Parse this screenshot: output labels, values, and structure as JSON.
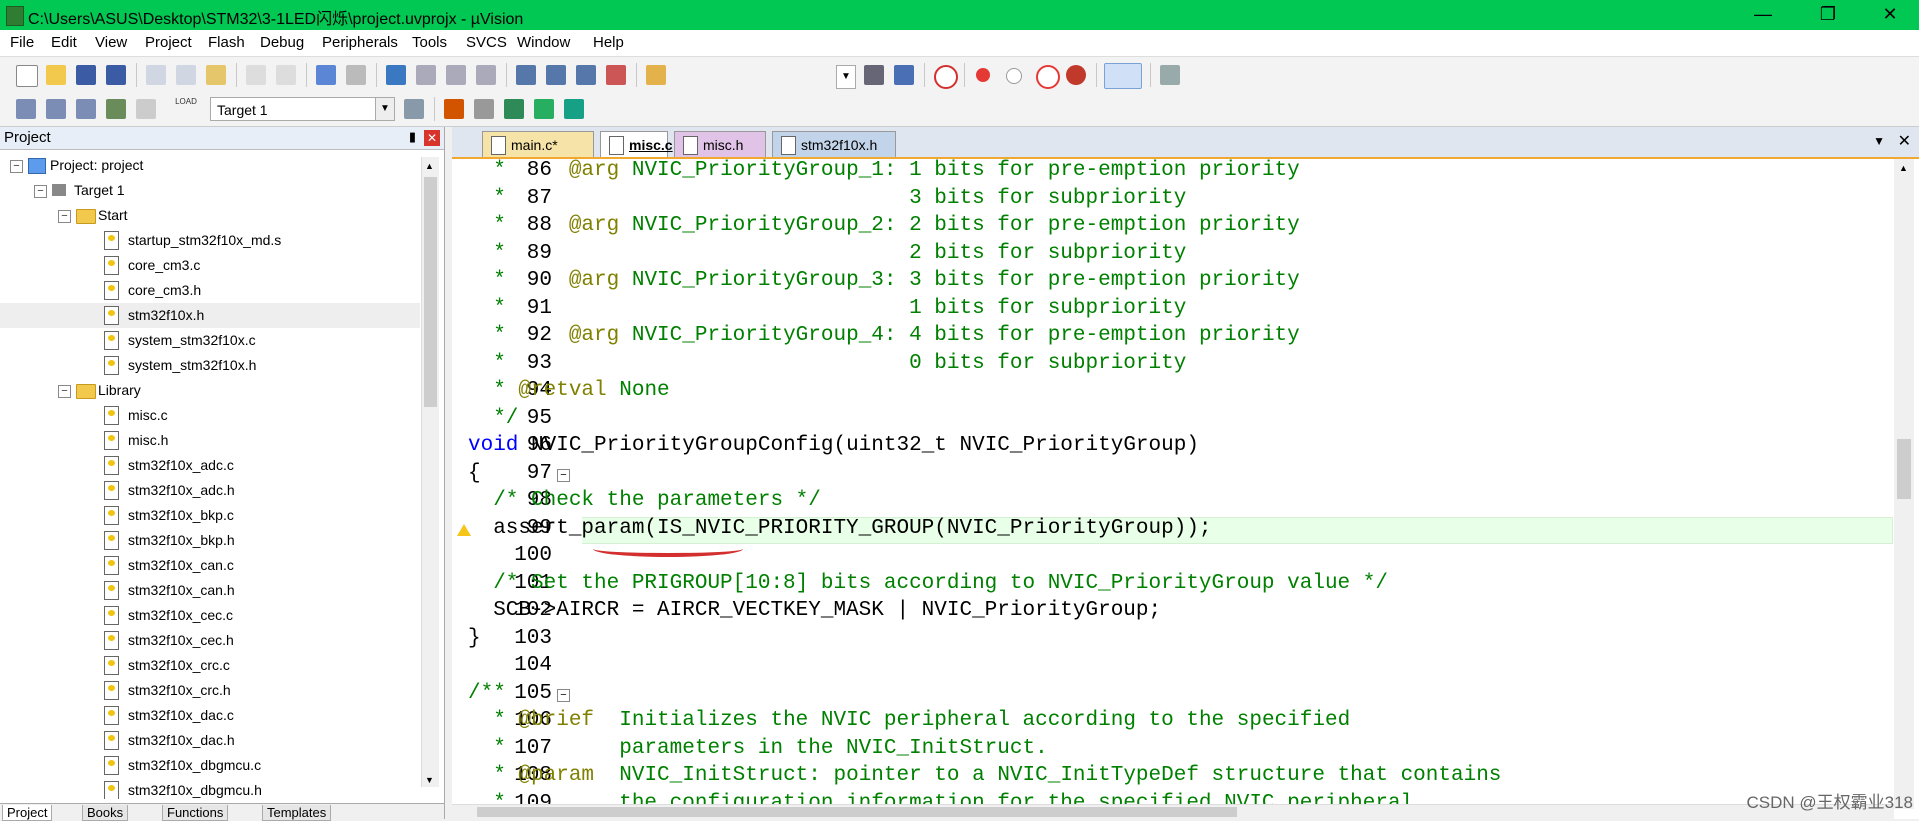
{
  "window": {
    "title": "C:\\Users\\ASUS\\Desktop\\STM32\\3-1LED闪烁\\project.uvprojx - µVision",
    "controls": [
      "minimize-icon",
      "maximize-icon",
      "close-icon"
    ],
    "colors": {
      "titlebar": "#00c853",
      "accent": "#f0a830"
    }
  },
  "menu": [
    "File",
    "Edit",
    "View",
    "Project",
    "Flash",
    "Debug",
    "Peripherals",
    "Tools",
    "SVCS",
    "Window",
    "Help"
  ],
  "toolbar2": {
    "target": "Target 1",
    "load_label": "LOAD"
  },
  "project_panel": {
    "title": "Project",
    "root": "Project: project",
    "target": "Target 1",
    "groups": [
      {
        "name": "Start",
        "files": [
          "startup_stm32f10x_md.s",
          "core_cm3.c",
          "core_cm3.h",
          "stm32f10x.h",
          "system_stm32f10x.c",
          "system_stm32f10x.h"
        ]
      },
      {
        "name": "Library",
        "files": [
          "misc.c",
          "misc.h",
          "stm32f10x_adc.c",
          "stm32f10x_adc.h",
          "stm32f10x_bkp.c",
          "stm32f10x_bkp.h",
          "stm32f10x_can.c",
          "stm32f10x_can.h",
          "stm32f10x_cec.c",
          "stm32f10x_cec.h",
          "stm32f10x_crc.c",
          "stm32f10x_crc.h",
          "stm32f10x_dac.c",
          "stm32f10x_dac.h",
          "stm32f10x_dbgmcu.c",
          "stm32f10x_dbgmcu.h"
        ]
      }
    ],
    "selected": "stm32f10x.h",
    "bottom_tabs": [
      "Project",
      "Books",
      "Functions",
      "Templates"
    ]
  },
  "editor": {
    "tabs": [
      {
        "label": "main.c*",
        "active": false
      },
      {
        "label": "misc.c",
        "active": true
      },
      {
        "label": "misc.h",
        "active": false
      },
      {
        "label": "stm32f10x.h",
        "active": false
      }
    ],
    "lines": [
      {
        "n": "86",
        "text": "  *     @arg NVIC_PriorityGroup_1: 1 bits for pre-emption priority"
      },
      {
        "n": "87",
        "text": "  *                                3 bits for subpriority"
      },
      {
        "n": "88",
        "text": "  *     @arg NVIC_PriorityGroup_2: 2 bits for pre-emption priority"
      },
      {
        "n": "89",
        "text": "  *                                2 bits for subpriority"
      },
      {
        "n": "90",
        "text": "  *     @arg NVIC_PriorityGroup_3: 3 bits for pre-emption priority"
      },
      {
        "n": "91",
        "text": "  *                                1 bits for subpriority"
      },
      {
        "n": "92",
        "text": "  *     @arg NVIC_PriorityGroup_4: 4 bits for pre-emption priority"
      },
      {
        "n": "93",
        "text": "  *                                0 bits for subpriority"
      },
      {
        "n": "94",
        "text": "  * @retval None"
      },
      {
        "n": "95",
        "text": "  */"
      },
      {
        "n": "96",
        "text": "void NVIC_PriorityGroupConfig(uint32_t NVIC_PriorityGroup)"
      },
      {
        "n": "97",
        "text": "{"
      },
      {
        "n": "98",
        "text": "  /* Check the parameters */"
      },
      {
        "n": "99",
        "text": "  assert_param(IS_NVIC_PRIORITY_GROUP(NVIC_PriorityGroup));"
      },
      {
        "n": "100",
        "text": ""
      },
      {
        "n": "101",
        "text": "  /* Set the PRIGROUP[10:8] bits according to NVIC_PriorityGroup value */"
      },
      {
        "n": "102",
        "text": "  SCB->AIRCR = AIRCR_VECTKEY_MASK | NVIC_PriorityGroup;"
      },
      {
        "n": "103",
        "text": "}"
      },
      {
        "n": "104",
        "text": ""
      },
      {
        "n": "105",
        "text": "/**"
      },
      {
        "n": "106",
        "text": "  * @brief  Initializes the NVIC peripheral according to the specified"
      },
      {
        "n": "107",
        "text": "  *         parameters in the NVIC_InitStruct."
      },
      {
        "n": "108",
        "text": "  * @param  NVIC_InitStruct: pointer to a NVIC_InitTypeDef structure that contains"
      },
      {
        "n": "109",
        "text": "  *         the configuration information for the specified NVIC peripheral."
      }
    ],
    "current_line": "99",
    "warning_line": "99"
  },
  "watermark": "CSDN @王权霸业318"
}
